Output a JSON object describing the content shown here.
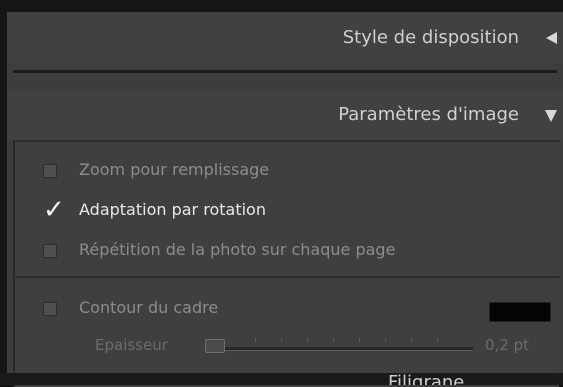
{
  "panel": {
    "section_layout_style": {
      "label": "Style de disposition",
      "state_icon": "collapse-left-triangle"
    },
    "section_image_settings": {
      "label": "Paramètres d'image",
      "state_icon": "expand-down-triangle"
    },
    "options": [
      {
        "label": "Zoom pour remplissage",
        "checked": false
      },
      {
        "label": "Adaptation par rotation",
        "checked": true
      },
      {
        "label": "Répétition de la photo sur chaque page",
        "checked": false
      }
    ],
    "frame_border": {
      "label": "Contour du cadre",
      "checked": false,
      "color": "#050505"
    },
    "thickness": {
      "label": "Epaisseur",
      "value": "0,2 pt"
    },
    "next_section_partial": "Filigrane"
  },
  "colors": {
    "panel_bg": "#3d3d3d",
    "header_bg": "#414141",
    "text_active": "#e8e8e8",
    "text_disabled": "#8c8c8c"
  }
}
